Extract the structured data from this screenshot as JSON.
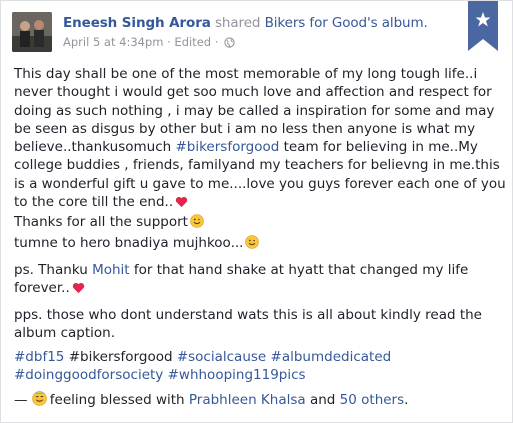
{
  "post": {
    "author": "Eneesh Singh Arora",
    "action": "shared",
    "target": "Bikers for Good's album.",
    "date": "April 5 at 4:34pm",
    "separator": "·",
    "edited": "Edited",
    "separator2": "·"
  },
  "body": {
    "p1_a": "This day shall be one of the most memorable of my long tough life..i never thought i would get soo much love and affection and respect for doing as such nothing , i may be called a inspiration for some and may be seen as disgus by other but i am no less then anyone is what my believe..thankusomuch ",
    "p1_tag": "#bikersforgood",
    "p1_b": " team for believing in me..My college buddies , friends, familyand my teachers for believng in me.this is a wonderful gift u gave to me....love you guys forever each one of you to the core till the end..",
    "p1_c": "Thanks for all the support",
    "p1_d": "tumne to hero bnadiya mujhkoo...",
    "p2_a": "ps. Thanku ",
    "p2_link": "Mohit",
    "p2_b": " for that hand shake at hyatt that changed my life forever..",
    "p3": "pps. those who dont understand wats this is all about kindly read the album caption.",
    "tags": [
      "#dbf15",
      "#bikersforgood",
      "#socialcause",
      "#albumdedicated",
      "#doinggoodforsociety",
      "#whhooping119pics"
    ],
    "feeling_dash": "— ",
    "feeling_text": "feeling blessed with ",
    "feeling_person": "Prabhleen Khalsa",
    "feeling_and": " and ",
    "feeling_others": "50 others",
    "feeling_end": "."
  },
  "colors": {
    "link": "#365899",
    "text": "#1d2129",
    "meta": "#90949c",
    "bookmark": "#4b67a1",
    "heart": "#e2264d",
    "emoji": "#f7c63d"
  },
  "icons": [
    "globe-icon",
    "bookmark-star-icon",
    "heart-icon",
    "smile-emoji-icon",
    "blessed-emoji-icon"
  ]
}
